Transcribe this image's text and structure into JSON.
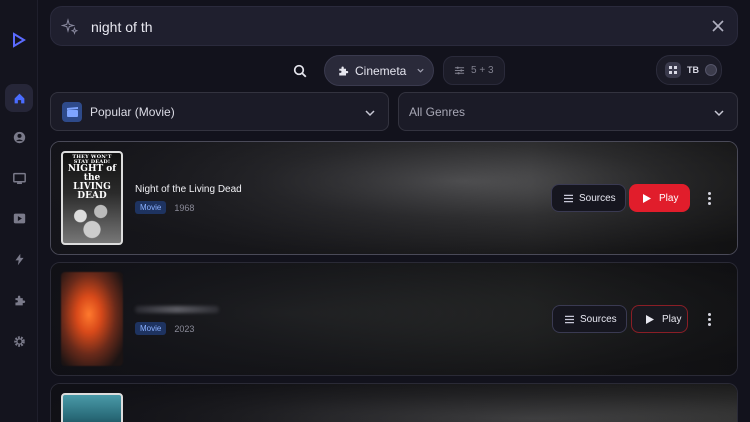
{
  "search": {
    "value": "night of th"
  },
  "filters": {
    "addon_label": "Cinemeta",
    "filter_count": "5 + 3",
    "user_initials": "TB"
  },
  "selects": {
    "type": "Popular (Movie)",
    "genre": "All Genres"
  },
  "results": [
    {
      "title": "Night of the Living Dead",
      "type": "Movie",
      "year": "1968",
      "sources_label": "Sources",
      "play_label": "Play",
      "poster_tagline": "THEY WON'T STAY DEAD!",
      "poster_title": "NIGHT of the LIVING DEAD"
    },
    {
      "title": "",
      "type": "Movie",
      "year": "2023",
      "sources_label": "Sources",
      "play_label": "Play"
    }
  ],
  "colors": {
    "accent": "#e11d2b",
    "badge": "#8ab0ff",
    "background": "#12121c"
  }
}
